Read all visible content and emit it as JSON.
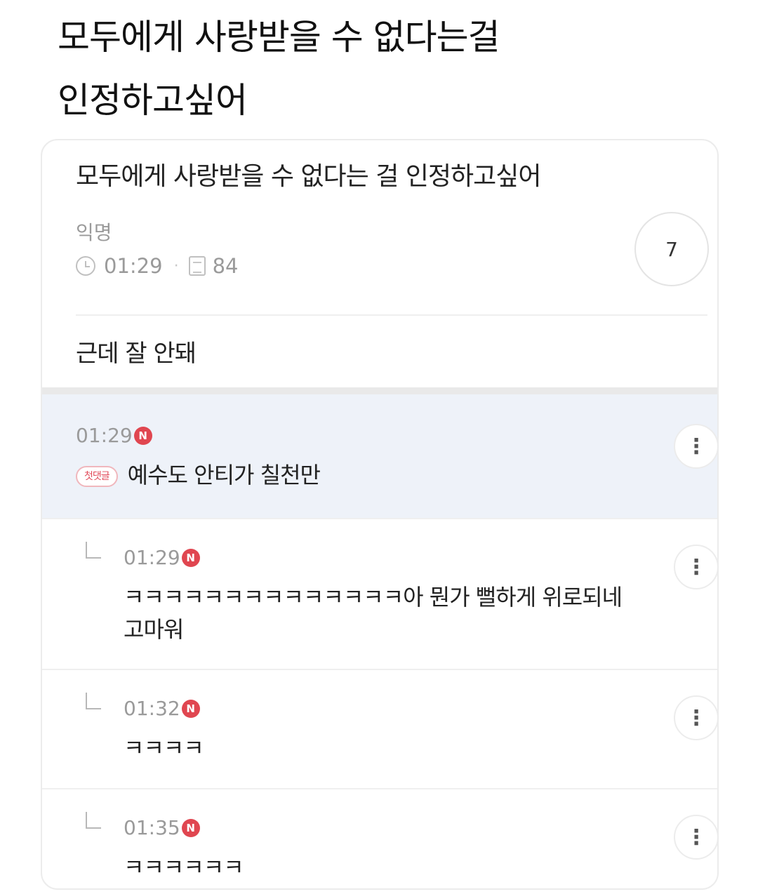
{
  "caption": {
    "line1": "모두에게 사랑받을 수 없다는걸",
    "line2": "인정하고싶어"
  },
  "post": {
    "title": "모두에게 사랑받을 수 없다는 걸 인정하고싶어",
    "author": "익명",
    "time": "01:29",
    "views": "84",
    "comment_count": "7",
    "body": "근데 잘 안돼"
  },
  "comments": [
    {
      "time": "01:29",
      "badge": "N",
      "tag": "첫댓글",
      "text": "예수도 안티가 칠천만",
      "is_reply": false
    },
    {
      "time": "01:29",
      "badge": "N",
      "text_line1": "ㅋㅋㅋㅋㅋㅋㅋㅋㅋㅋㅋㅋㅋㅋ아 뭔가 뻘하게 위로되네",
      "text_line2": "고마워",
      "is_reply": true
    },
    {
      "time": "01:32",
      "badge": "N",
      "text": "ㅋㅋㅋㅋ",
      "is_reply": true
    },
    {
      "time": "01:35",
      "badge": "N",
      "text": "ㅋㅋㅋㅋㅋㅋ",
      "is_reply": true
    }
  ],
  "icons": {
    "more": "more-vertical-icon",
    "clock": "clock-icon",
    "views": "document-icon",
    "reply": "reply-arrow-icon"
  },
  "colors": {
    "new_badge": "#e04650",
    "highlight_bg": "#eef2f9",
    "meta_text": "#9a9a9a"
  },
  "more_glyph": "⋮"
}
